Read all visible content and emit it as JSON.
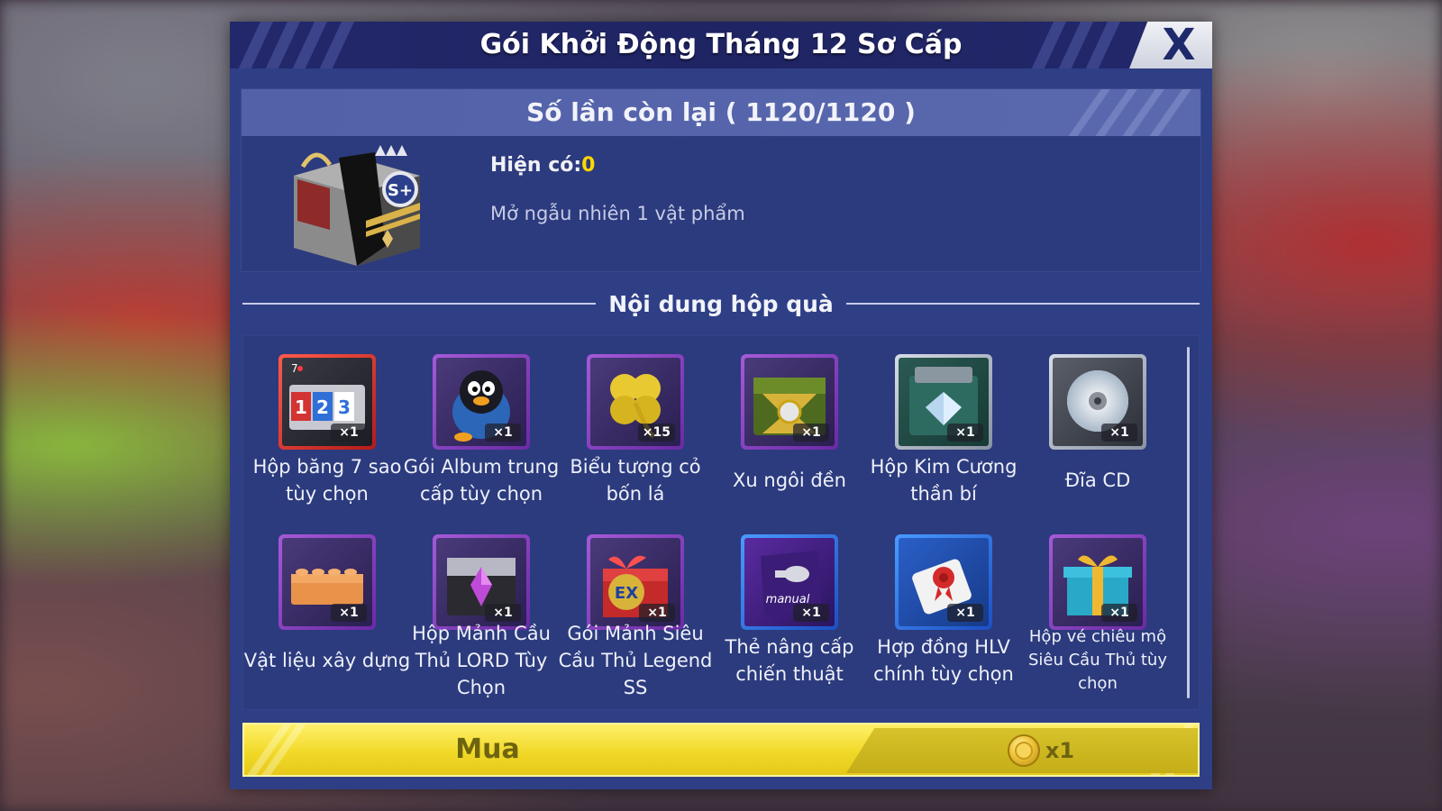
{
  "dialog": {
    "title": "Gói Khởi Động Tháng 12 Sơ Cấp",
    "close_label": "X"
  },
  "info": {
    "remaining_text": "Số lần còn lại ( 1120/1120 )",
    "owned_label": "Hiện có:",
    "owned_value": "0",
    "description": "Mở ngẫu nhiên 1 vật phẩm"
  },
  "contents": {
    "heading": "Nội dung hộp quà",
    "items": [
      {
        "name": "Hộp băng 7 sao tùy chọn",
        "qty": "×1",
        "frame": "red",
        "icon": "tape-box-icon"
      },
      {
        "name": "Gói Album trung cấp tùy chọn",
        "qty": "×1",
        "frame": "purple",
        "icon": "penguin-backpack-icon"
      },
      {
        "name": "Biểu tượng cỏ bốn lá",
        "qty": "×15",
        "frame": "purple",
        "icon": "four-leaf-clover-icon"
      },
      {
        "name": "Xu ngôi đền",
        "qty": "×1",
        "frame": "purple",
        "icon": "temple-chest-icon"
      },
      {
        "name": "Hộp Kim Cương thần bí",
        "qty": "×1",
        "frame": "gray",
        "icon": "diamond-box-icon"
      },
      {
        "name": "Đĩa CD",
        "qty": "×1",
        "frame": "gray",
        "icon": "cd-disc-icon"
      },
      {
        "name": "Vật liệu xây dựng",
        "qty": "×1",
        "frame": "purple",
        "icon": "lego-brick-icon"
      },
      {
        "name": "Hộp Mảnh Cầu Thủ LORD Tùy Chọn",
        "qty": "×1",
        "frame": "purple",
        "icon": "crystal-chest-icon"
      },
      {
        "name": "Gói Mảnh Siêu Cầu Thủ Legend SS",
        "qty": "×1",
        "frame": "purple",
        "icon": "ex-gift-box-icon"
      },
      {
        "name": "Thẻ nâng cấp chiến thuật",
        "qty": "×1",
        "frame": "blue",
        "icon": "whistle-card-icon"
      },
      {
        "name": "Hợp đồng HLV chính tùy chọn",
        "qty": "×1",
        "frame": "blue",
        "icon": "scroll-contract-icon"
      },
      {
        "name": "Hộp vé chiêu mộ Siêu Cầu Thủ tùy chọn",
        "qty": "×1",
        "frame": "purple",
        "icon": "gift-box-icon"
      }
    ]
  },
  "buy": {
    "label": "Mua",
    "price_qty": "x1",
    "currency_icon": "coin-icon"
  },
  "colors": {
    "dialog_bg": "#2f3f86",
    "title_bg": "#22286a",
    "buy_bar": "#f1d928",
    "owned_value": "#ffd700"
  }
}
